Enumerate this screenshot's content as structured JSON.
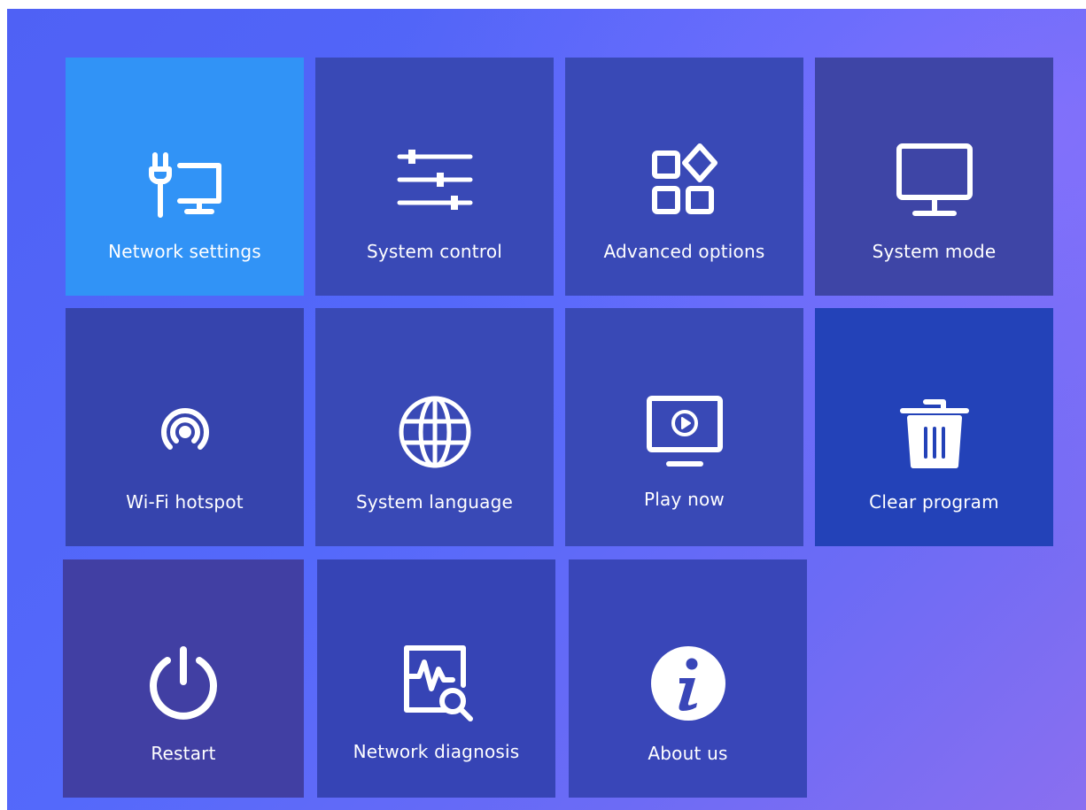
{
  "menu": {
    "selected_index": 0,
    "tiles": [
      {
        "id": "network-settings",
        "label": "Network settings",
        "icon": "ethernet-monitor-icon"
      },
      {
        "id": "system-control",
        "label": "System control",
        "icon": "sliders-icon"
      },
      {
        "id": "advanced-options",
        "label": "Advanced options",
        "icon": "apps-grid-icon"
      },
      {
        "id": "system-mode",
        "label": "System mode",
        "icon": "monitor-icon"
      },
      {
        "id": "wifi-hotspot",
        "label": "Wi-Fi hotspot",
        "icon": "hotspot-icon"
      },
      {
        "id": "system-language",
        "label": "System language",
        "icon": "globe-icon"
      },
      {
        "id": "play-now",
        "label": "Play now",
        "icon": "tv-play-icon"
      },
      {
        "id": "clear-program",
        "label": "Clear program",
        "icon": "trash-icon"
      },
      {
        "id": "restart",
        "label": "Restart",
        "icon": "power-icon"
      },
      {
        "id": "network-diagnosis",
        "label": "Network diagnosis",
        "icon": "diagnosis-icon"
      },
      {
        "id": "about-us",
        "label": "About us",
        "icon": "info-icon"
      }
    ]
  },
  "colors": {
    "background": "#5469fb",
    "tile": "#3949b6",
    "tile_selected": "#3193f6",
    "text": "#ffffff"
  }
}
